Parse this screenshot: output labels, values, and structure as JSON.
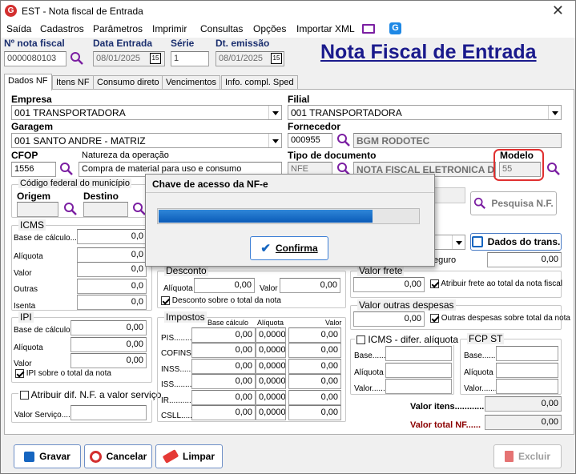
{
  "window": {
    "title": "EST - Nota fiscal de Entrada",
    "close_glyph": "✕"
  },
  "menu": [
    "Saída",
    "Cadastros",
    "Parâmetros",
    "Imprimir",
    "Consultas",
    "Opções",
    "Importar XML"
  ],
  "header": {
    "nota_label": "Nº nota fiscal",
    "nota_value": "0000080103",
    "data_entrada_label": "Data Entrada",
    "data_entrada_value": "08/01/2025",
    "serie_label": "Série",
    "serie_value": "1",
    "dt_emissao_label": "Dt. emissão",
    "dt_emissao_value": "08/01/2025",
    "big_title": "Nota Fiscal de Entrada",
    "cal_glyph": "15"
  },
  "tabs": [
    "Dados NF",
    "Itens NF",
    "Consumo direto",
    "Vencimentos",
    "Info. compl. Sped"
  ],
  "form": {
    "empresa_label": "Empresa",
    "empresa_value": "001 TRANSPORTADORA",
    "filial_label": "Filial",
    "filial_value": "001 TRANSPORTADORA",
    "garagem_label": "Garagem",
    "garagem_value": "001 SANTO ANDRE - MATRIZ",
    "fornecedor_label": "Fornecedor",
    "fornecedor_code": "000955",
    "fornecedor_name": "BGM RODOTEC",
    "cfop_label": "CFOP",
    "cfop_value": "1556",
    "natureza_label": "Natureza da operação",
    "natureza_value": "Compra de material para uso e consumo",
    "tipo_doc_label": "Tipo de documento",
    "tipo_doc_code": "NFE",
    "tipo_doc_name": "NOTA FISCAL ELETRONICA DE",
    "modelo_label": "Modelo",
    "modelo_value": "55",
    "cod_municipio_label": "Código federal do município",
    "origem_label": "Origem",
    "destino_label": "Destino",
    "pesquisa_label": "Pesquisa N.F.",
    "dados_trans_label": "Dados do trans.",
    "seguro_label": "eguro",
    "seguro_value": "0,00"
  },
  "icms": {
    "title": "ICMS",
    "rows": [
      {
        "label": "Base de cálculo....",
        "value": "0,0"
      },
      {
        "label": "Alíquota",
        "value": "0,0"
      },
      {
        "label": "Valor",
        "value": "0,0"
      },
      {
        "label": "Outras",
        "value": "0,0"
      },
      {
        "label": "Isenta",
        "value": "0,0"
      }
    ]
  },
  "ipi": {
    "title": "IPI",
    "rows": [
      {
        "label": "Base de cálculo....",
        "value": "0,00"
      },
      {
        "label": "Alíquota",
        "value": "0,00"
      },
      {
        "label": "Valor",
        "value": "0,00"
      }
    ],
    "checkbox": "IPI sobre o total da nota"
  },
  "desconto": {
    "title": "Desconto",
    "aliquota_label": "Alíquota",
    "aliquota_value": "0,00",
    "valor_label": "Valor",
    "valor_value": "0,00",
    "checkbox": "Desconto sobre o total da nota"
  },
  "impostos": {
    "title": "Impostos",
    "headers": [
      "Base cálculo",
      "Alíquota",
      "Valor"
    ],
    "rows": [
      {
        "label": "PIS........",
        "base": "0,00",
        "aliq": "0,0000",
        "valor": "0,00"
      },
      {
        "label": "COFINS....",
        "base": "0,00",
        "aliq": "0,0000",
        "valor": "0,00"
      },
      {
        "label": "INSS........",
        "base": "0,00",
        "aliq": "0,0000",
        "valor": "0,00"
      },
      {
        "label": "ISS..........",
        "base": "0,00",
        "aliq": "0,0000",
        "valor": "0,00"
      },
      {
        "label": "IR...........",
        "base": "0,00",
        "aliq": "0,0000",
        "valor": "0,00"
      },
      {
        "label": "CSLL........",
        "base": "0,00",
        "aliq": "0,0000",
        "valor": "0,00"
      }
    ]
  },
  "atribuir": {
    "checkbox": "Atribuir dif. N.F. a valor serviço",
    "valor_label": "Valor Serviço....."
  },
  "frete": {
    "title": "Valor frete",
    "value": "0,00",
    "checkbox": "Atribuir frete ao total da nota fiscal"
  },
  "outras": {
    "title": "Valor outras despesas",
    "value": "0,00",
    "checkbox": "Outras despesas sobre total da nota"
  },
  "icms_dif": {
    "title": "ICMS - difer. alíquota",
    "rows": [
      "Base.........",
      "Alíquota",
      "Valor........"
    ]
  },
  "fcp": {
    "title": "FCP ST",
    "rows": [
      "Base.........",
      "Alíquota",
      "Valor........"
    ]
  },
  "totais": {
    "itens_label": "Valor itens............",
    "itens_value": "0,00",
    "total_label": "Valor total NF......",
    "total_value": "0,00"
  },
  "buttons": {
    "gravar": "Gravar",
    "cancelar": "Cancelar",
    "limpar": "Limpar",
    "excluir": "Excluir"
  },
  "dialog": {
    "title": "Chave de acesso da NF-e",
    "progress": 0.82,
    "confirm": "Confirma"
  }
}
